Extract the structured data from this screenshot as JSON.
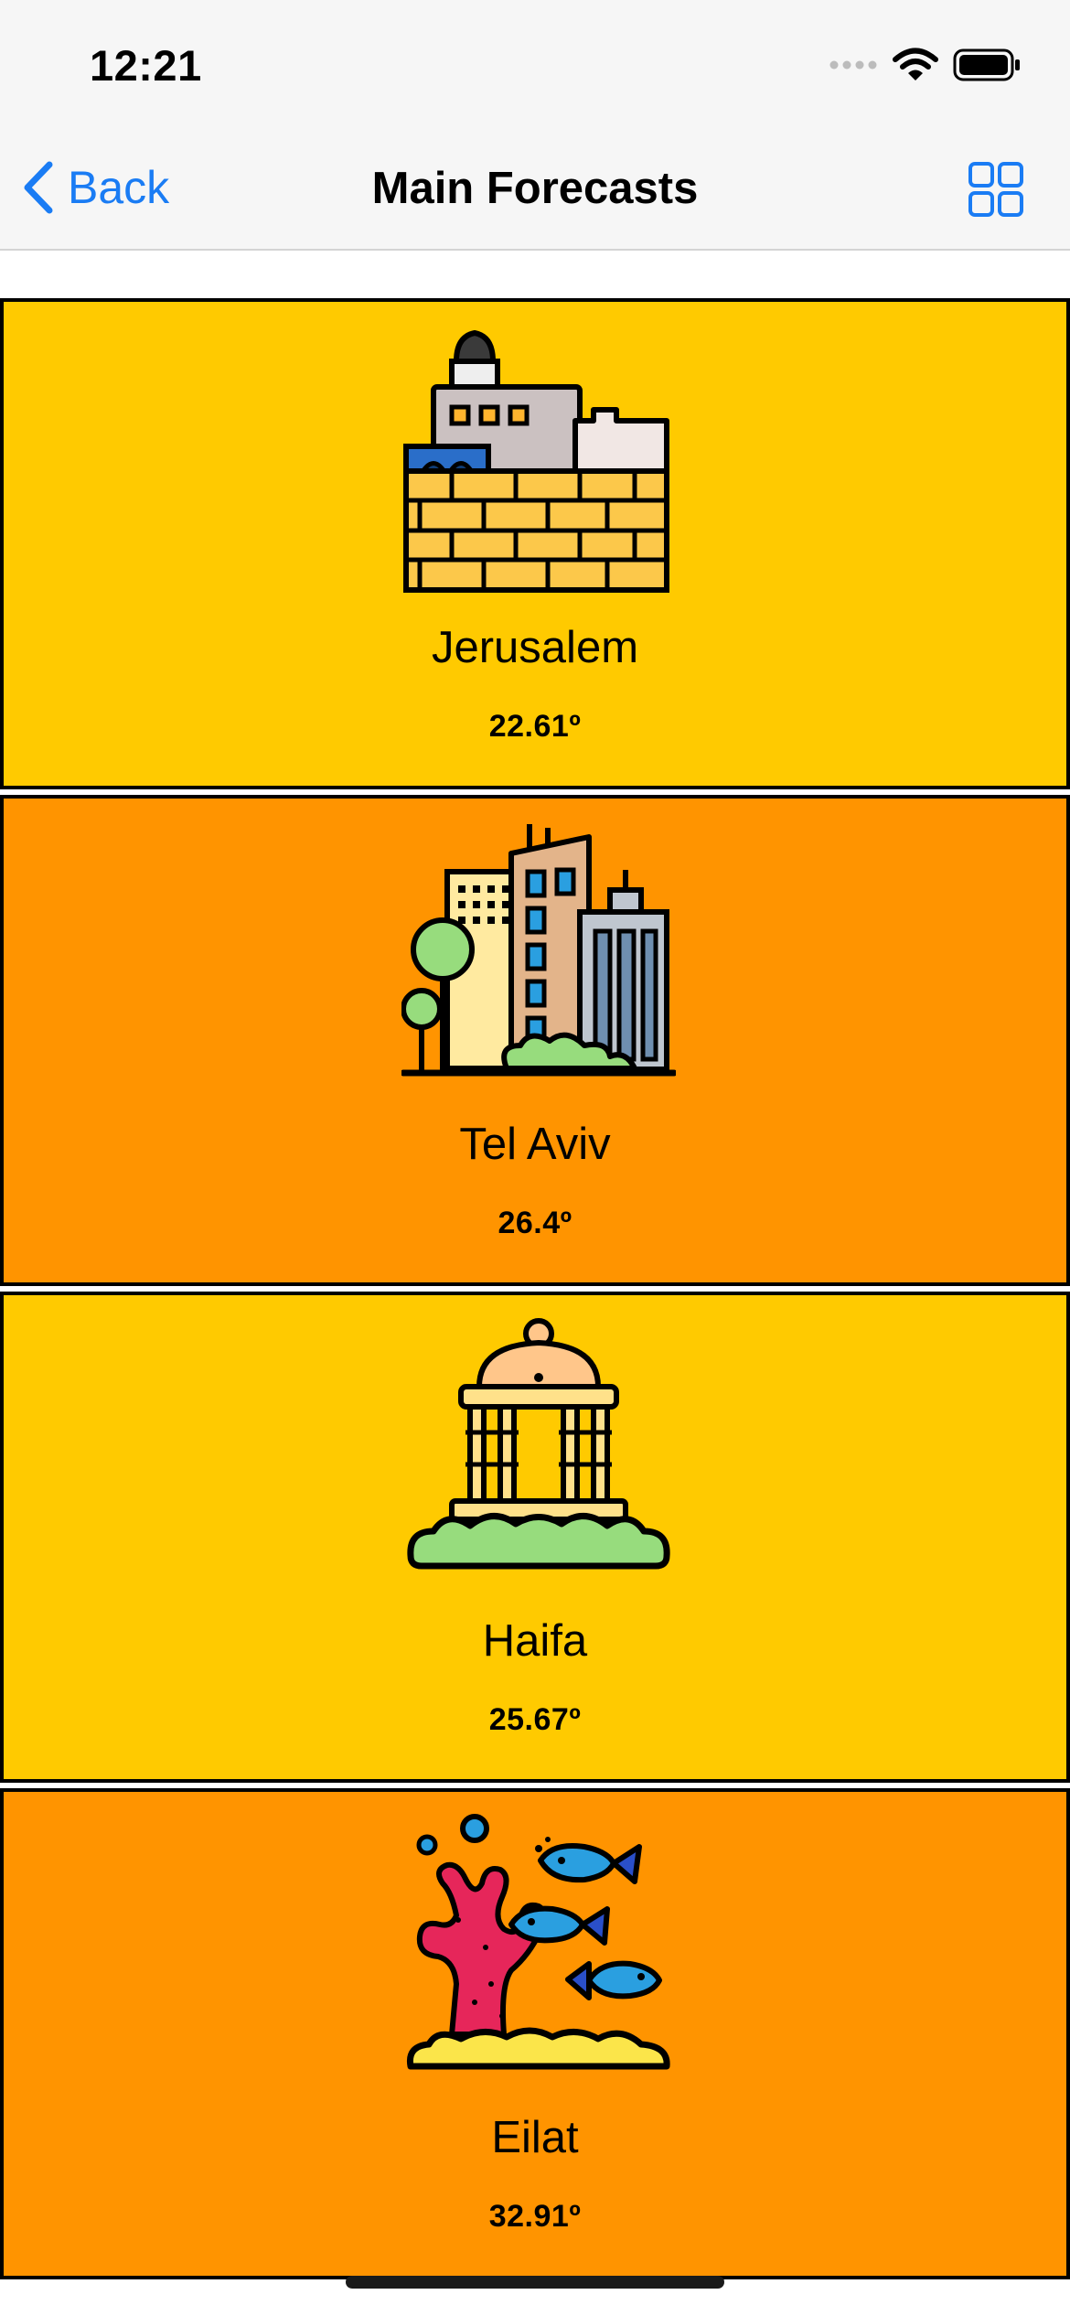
{
  "status_bar": {
    "time": "12:21"
  },
  "nav": {
    "back_label": "Back",
    "title": "Main Forecasts",
    "layout_icon": "grid-icon"
  },
  "colors": {
    "accent": "#1a7cf4",
    "card_yellow": "#ffca00",
    "card_orange": "#ff9400"
  },
  "cities": [
    {
      "name": "Jerusalem",
      "temp": "22.61º",
      "icon": "old-city-wall-icon"
    },
    {
      "name": "Tel Aviv",
      "temp": "26.4º",
      "icon": "city-skyline-icon"
    },
    {
      "name": "Haifa",
      "temp": "25.67º",
      "icon": "dome-shrine-icon"
    },
    {
      "name": "Eilat",
      "temp": "32.91º",
      "icon": "coral-reef-fish-icon"
    }
  ]
}
